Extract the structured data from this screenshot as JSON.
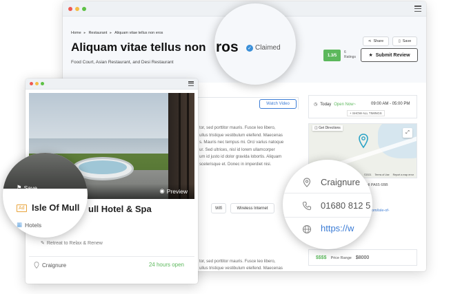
{
  "listing": {
    "breadcrumb": [
      "Home",
      "Restaurant",
      "Aliquam vitae tellus non eros"
    ],
    "title_prefix": "Aliquam vitae tellus non",
    "title_suffix": "ros",
    "claimed_label": "Claimed",
    "subtitle": "Food Court, Asian Restaurant, and Desi Restaurant",
    "share_label": "Share",
    "save_label": "Save",
    "rating_value": "1.3/5",
    "rating_count": "6",
    "rating_label": "Ratings",
    "submit_review_label": "Submit Review",
    "watch_video_label": "Watch Video",
    "description_lines": [
      "tor, sed porttitor mauris. Fusce leo libero,",
      "ullus tristique vestibulum eleifend. Maecenas",
      "s. Mauris nec tempus mi. Orci varius natoque",
      "ur. Sed ultrices, nisl id lorem ullamcorper",
      "um id justo id dolor gravida lobortis. Aliquam",
      "scelerisque et. Donec in imperdiet nisi."
    ],
    "description_bottom_lines": [
      "tor, sed porttitor mauris. Fusce leo libero,",
      "ullus tristique vestibulum eleifend. Maecenas"
    ],
    "tags": [
      "Wifi",
      "Wireless Internet"
    ],
    "today_label": "Today",
    "open_now": "Open Now~",
    "hours": "09:00 AM - 05:00 PM",
    "show_all_timings": "+ SHOW ALL TIMINGS",
    "get_directions": "Get Directions",
    "map_terms": "Terms of Use",
    "map_report": "Report a map error",
    "map_copy": "©2021",
    "address_short": "of Mull PA65 6BB",
    "website_short": "hotels.com/isle-of-",
    "address_zoom": "Craignure",
    "phone_zoom": "01680 812 5",
    "website_zoom": "https://w",
    "price_symbol": "$$$$",
    "price_label": "Price Range",
    "price_value": "$8000"
  },
  "card": {
    "save_label": "Save",
    "preview_label": "Preview",
    "ad_badge": "Ad",
    "title_zoom": "Isle Of Mull",
    "title_rest": "ull Hotel & Spa",
    "category": "Hotels",
    "tagline": "Retreat to Relax & Renew",
    "location": "Craignure",
    "hours_status": "24 hours open"
  },
  "colors": {
    "accent_blue": "#3a7bd5",
    "open_green": "#5cb85c",
    "ad_orange": "#e8a33a"
  }
}
